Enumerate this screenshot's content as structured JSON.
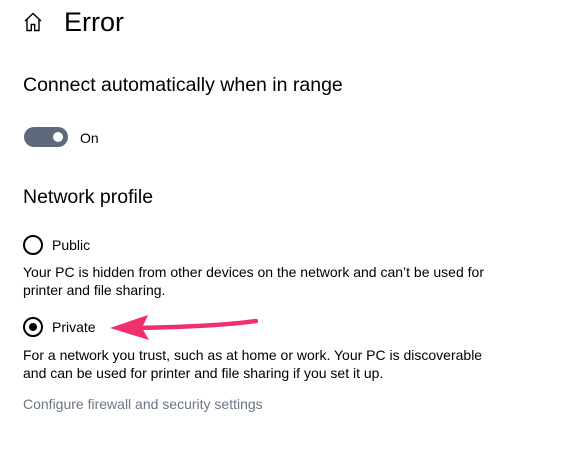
{
  "header": {
    "home_icon": "home-icon",
    "title": "Error"
  },
  "connect_auto": {
    "heading": "Connect automatically when in range",
    "toggle": {
      "state_label": "On",
      "checked": true,
      "track_color": "#5e6a7b"
    }
  },
  "network_profile": {
    "heading": "Network profile",
    "options": [
      {
        "label": "Public",
        "selected": false,
        "description": "Your PC is hidden from other devices on the network and can’t be used for printer and file sharing."
      },
      {
        "label": "Private",
        "selected": true,
        "description": "For a network you trust, such as at home or work. Your PC is discoverable and can be used for printer and file sharing if you set it up."
      }
    ]
  },
  "firewall_link": {
    "text": "Configure firewall and security settings",
    "color": "#6b7686"
  },
  "annotation": {
    "arrow_color": "#f0306c",
    "points_to": "Private"
  }
}
